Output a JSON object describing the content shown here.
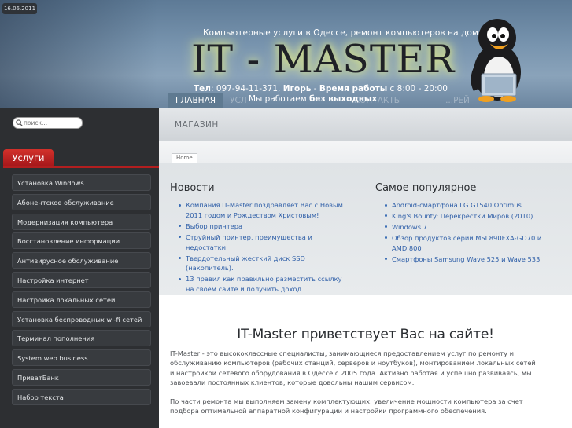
{
  "header": {
    "date": "16.06.2011",
    "tagline": "Компьютерные услуги в Одессе, ремонт компьютеров на дому",
    "logo": "IT - MASTER",
    "contacts": {
      "phone_label": "Тел",
      "phone": ": 097-94-11-371, ",
      "name": "Игорь",
      "sep": " - ",
      "hours_label": "Время работы",
      "hours": " с 8:00 - 20:00"
    },
    "slogan_prefix": "Мы работаем ",
    "slogan_bold": "без выходных",
    "nav": [
      "ГЛАВНАЯ",
      "УСЛ",
      "КОНТАКТЫ",
      "...РЕЙ"
    ]
  },
  "sidebar": {
    "search_placeholder": "поиск...",
    "services_label": "Услуги",
    "menu": [
      "Установка Windows",
      "Абонентское обслуживание",
      "Модернизация компьютера",
      "Восстановление информации",
      "Антивирусное обслуживание",
      "Настройка интернет",
      "Настройка локальных сетей",
      "Установка беспроводных wi-fi сетей",
      "Терминал пополнения",
      "System web business",
      "ПриватБанк",
      "Набор текста"
    ]
  },
  "main": {
    "section_title": "МАГАЗИН",
    "breadcrumb": "Home",
    "news": {
      "title": "Новости",
      "items": [
        "Компания IT-Master поздравляет Вас с Новым 2011 годом и Рождеством Христовым!",
        "Выбор принтера",
        "Струйный принтер, преимущества и недостатки",
        "Твердотельный жесткий диск SSD (накопитель).",
        "13 правил как правильно разместить ссылку на своем сайте и получить доход."
      ]
    },
    "popular": {
      "title": "Самое популярное",
      "items": [
        "Android-смартфона LG GT540 Optimus",
        "King's Bounty: Перекрестки Миров (2010)",
        "Windows 7",
        "Обзор продуктов серии MSI 890FXA-GD70 и AMD 800",
        "Смартфоны Samsung Wave 525 и Wave 533"
      ]
    },
    "welcome_title": "IT-Master приветствует Вас на сайте!",
    "paragraphs": [
      "IT-Master - это высококлассные специалисты, занимающиеся предоставлением услуг по ремонту и обслуживанию компьютеров (рабочих станций, серверов и ноутбуков), монтированием локальных сетей и настройкой сетевого оборудования в Одессе с 2005 года. Активно работая и успешно развиваясь, мы  завоевали постоянных клиентов, которые довольны нашим сервисом.",
      "По части ремонта мы выполняем замену комплектующих, увеличение мощности компьютера за счет подбора оптимальной аппаратной конфигурации и настройки программного обеспечения."
    ]
  }
}
